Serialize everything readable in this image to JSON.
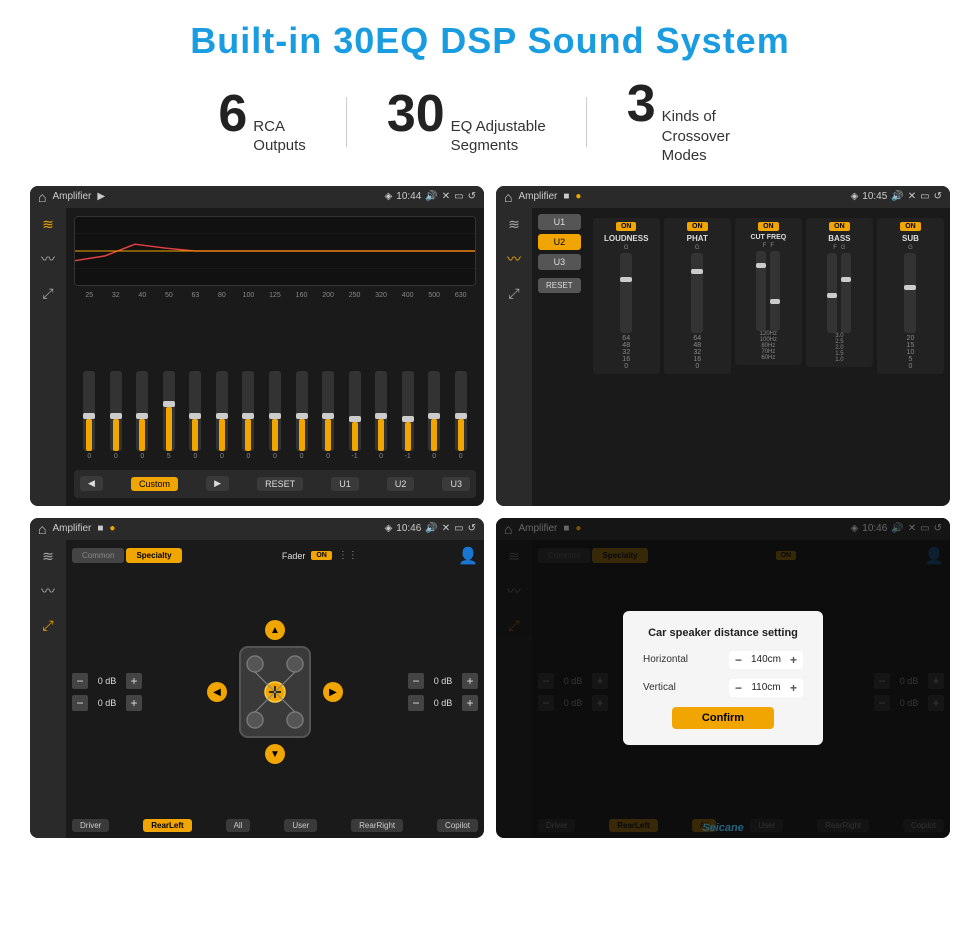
{
  "title": "Built-in 30EQ DSP Sound System",
  "stats": [
    {
      "number": "6",
      "text": "RCA\nOutputs"
    },
    {
      "number": "30",
      "text": "EQ Adjustable\nSegments"
    },
    {
      "number": "3",
      "text": "Kinds of\nCrossover Modes"
    }
  ],
  "screens": {
    "screen1": {
      "appName": "Amplifier",
      "time": "10:44",
      "freqLabels": [
        "25",
        "32",
        "40",
        "50",
        "63",
        "80",
        "100",
        "125",
        "160",
        "200",
        "250",
        "320",
        "400",
        "500",
        "630"
      ],
      "sliderValues": [
        0,
        0,
        0,
        5,
        0,
        0,
        0,
        0,
        0,
        0,
        -1,
        0,
        -1
      ],
      "bottomBtns": [
        "Custom",
        "RESET",
        "U1",
        "U2",
        "U3"
      ]
    },
    "screen2": {
      "appName": "Amplifier",
      "time": "10:45",
      "presetBtns": [
        "U1",
        "U2",
        "U3"
      ],
      "channels": [
        {
          "label": "LOUDNESS",
          "on": true
        },
        {
          "label": "PHAT",
          "on": true
        },
        {
          "label": "CUT FREQ",
          "on": true
        },
        {
          "label": "BASS",
          "on": true
        },
        {
          "label": "SUB",
          "on": true
        }
      ]
    },
    "screen3": {
      "appName": "Amplifier",
      "time": "10:46",
      "tabs": [
        "Common",
        "Specialty"
      ],
      "faderLabel": "Fader",
      "zones": [
        "Driver",
        "RearLeft",
        "All",
        "User",
        "RearRight",
        "Copilot"
      ],
      "activeZone": "All",
      "volValues": [
        "0 dB",
        "0 dB",
        "0 dB",
        "0 dB"
      ]
    },
    "screen4": {
      "appName": "Amplifier",
      "time": "10:46",
      "dialog": {
        "title": "Car speaker distance setting",
        "rows": [
          {
            "label": "Horizontal",
            "value": "140cm"
          },
          {
            "label": "Vertical",
            "value": "110cm"
          }
        ],
        "confirmBtn": "Confirm"
      },
      "watermark": "Seicane"
    }
  }
}
